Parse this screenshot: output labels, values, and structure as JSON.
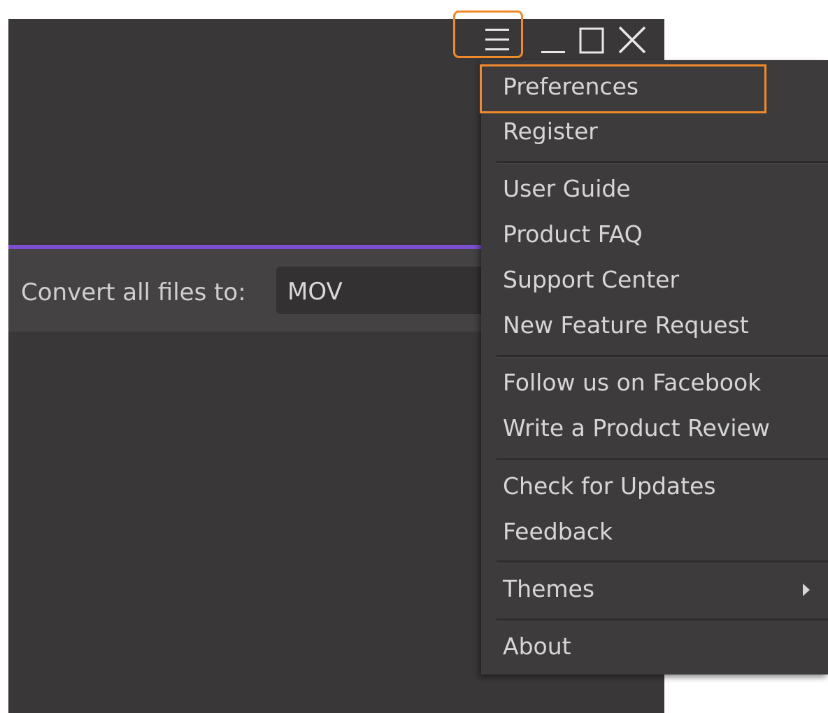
{
  "window": {
    "controls": {
      "menu_icon": "hamburger-menu-icon",
      "minimize_icon": "minimize-icon",
      "maximize_icon": "maximize-icon",
      "close_icon": "close-icon"
    }
  },
  "convert_bar": {
    "label": "Convert all files to:",
    "format_value": "MOV"
  },
  "menu": {
    "items": [
      {
        "label": "Preferences"
      },
      {
        "label": "Register"
      },
      {
        "label": "User Guide"
      },
      {
        "label": "Product FAQ"
      },
      {
        "label": "Support Center"
      },
      {
        "label": "New Feature Request"
      },
      {
        "label": "Follow us on Facebook"
      },
      {
        "label": "Write a Product Review"
      },
      {
        "label": "Check for Updates"
      },
      {
        "label": "Feedback"
      },
      {
        "label": "Themes"
      },
      {
        "label": "About"
      }
    ]
  },
  "colors": {
    "background_dark": "#3a3738",
    "accent_purple": "#7e4ed1",
    "highlight_orange": "#f08a2a",
    "menu_bg": "#3e3b3c",
    "text": "#d6d6d6"
  }
}
